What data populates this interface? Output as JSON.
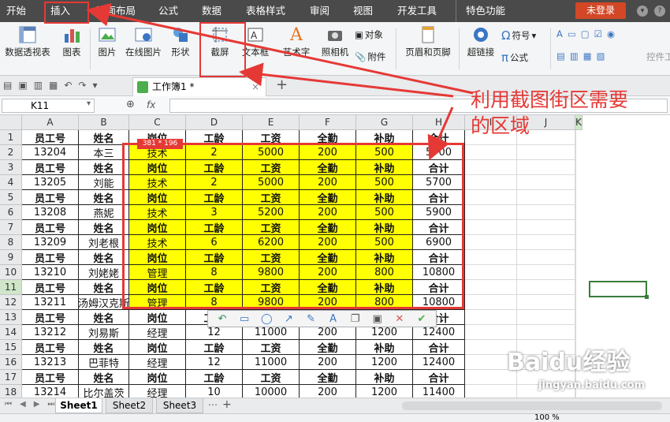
{
  "menu": {
    "items": [
      "开始",
      "插入",
      "页面布局",
      "公式",
      "数据",
      "表格样式",
      "审阅",
      "视图",
      "开发工具",
      "特色功能"
    ],
    "login": "未登录"
  },
  "ribbon": {
    "pivot": "数据透视表",
    "chart": "图表",
    "picture": "图片",
    "online_picture": "在线图片",
    "shapes": "形状",
    "screenshot": "截屏",
    "textbox": "文本框",
    "wordart": "艺术字",
    "camera": "照相机",
    "object": "对象",
    "attachment": "附件",
    "header_footer": "页眉和页脚",
    "hyperlink": "超链接",
    "symbol": "符号",
    "formula": "公式",
    "controls": "控件工"
  },
  "tabs": {
    "doc_title": "工作簿1 *",
    "add": "+"
  },
  "formula_bar": {
    "name_box": "K11",
    "fx": "fx"
  },
  "grid": {
    "columns": [
      "A",
      "B",
      "C",
      "D",
      "E",
      "F",
      "G",
      "H",
      "I",
      "J",
      "K"
    ],
    "rows": [
      {
        "n": "1",
        "cells": [
          "员工号",
          "姓名",
          "岗位",
          "工龄",
          "工资",
          "全勤",
          "补助",
          "合计"
        ],
        "h": true
      },
      {
        "n": "2",
        "cells": [
          "13204",
          "本三",
          "技术",
          "2",
          "5000",
          "200",
          "500",
          "5700"
        ],
        "h": false
      },
      {
        "n": "3",
        "cells": [
          "员工号",
          "姓名",
          "岗位",
          "工龄",
          "工资",
          "全勤",
          "补助",
          "合计"
        ],
        "h": true
      },
      {
        "n": "4",
        "cells": [
          "13205",
          "刘能",
          "技术",
          "2",
          "5000",
          "200",
          "500",
          "5700"
        ],
        "h": false
      },
      {
        "n": "5",
        "cells": [
          "员工号",
          "姓名",
          "岗位",
          "工龄",
          "工资",
          "全勤",
          "补助",
          "合计"
        ],
        "h": true
      },
      {
        "n": "6",
        "cells": [
          "13208",
          "燕妮",
          "技术",
          "3",
          "5200",
          "200",
          "500",
          "5900"
        ],
        "h": false
      },
      {
        "n": "7",
        "cells": [
          "员工号",
          "姓名",
          "岗位",
          "工龄",
          "工资",
          "全勤",
          "补助",
          "合计"
        ],
        "h": true
      },
      {
        "n": "8",
        "cells": [
          "13209",
          "刘老根",
          "技术",
          "6",
          "6200",
          "200",
          "500",
          "6900"
        ],
        "h": false
      },
      {
        "n": "9",
        "cells": [
          "员工号",
          "姓名",
          "岗位",
          "工龄",
          "工资",
          "全勤",
          "补助",
          "合计"
        ],
        "h": true
      },
      {
        "n": "10",
        "cells": [
          "13210",
          "刘姥姥",
          "管理",
          "8",
          "9800",
          "200",
          "800",
          "10800"
        ],
        "h": false
      },
      {
        "n": "11",
        "cells": [
          "员工号",
          "姓名",
          "岗位",
          "工龄",
          "工资",
          "全勤",
          "补助",
          "合计"
        ],
        "h": true
      },
      {
        "n": "12",
        "cells": [
          "13211",
          "汤姆汉克斯",
          "管理",
          "8",
          "9800",
          "200",
          "800",
          "10800"
        ],
        "h": false
      },
      {
        "n": "13",
        "cells": [
          "员工号",
          "姓名",
          "岗位",
          "工龄",
          "工资",
          "全勤",
          "补助",
          "合计"
        ],
        "h": true
      },
      {
        "n": "14",
        "cells": [
          "13212",
          "刘易斯",
          "经理",
          "12",
          "11000",
          "200",
          "1200",
          "12400"
        ],
        "h": false
      },
      {
        "n": "15",
        "cells": [
          "员工号",
          "姓名",
          "岗位",
          "工龄",
          "工资",
          "全勤",
          "补助",
          "合计"
        ],
        "h": true
      },
      {
        "n": "16",
        "cells": [
          "13213",
          "巴菲特",
          "经理",
          "12",
          "11000",
          "200",
          "1200",
          "12400"
        ],
        "h": false
      },
      {
        "n": "17",
        "cells": [
          "员工号",
          "姓名",
          "岗位",
          "工龄",
          "工资",
          "全勤",
          "补助",
          "合计"
        ],
        "h": true
      },
      {
        "n": "18",
        "cells": [
          "13214",
          "比尔盖茨",
          "经理",
          "10",
          "10000",
          "200",
          "1200",
          "11400"
        ],
        "h": false
      }
    ]
  },
  "sheets": [
    "Sheet1",
    "Sheet2",
    "Sheet3"
  ],
  "status": {
    "zoom": "100 %"
  },
  "annotation": {
    "text_line1": "利用截图街区需要",
    "text_line2": "的区域",
    "dimensions": "381 * 196",
    "color": "#e53935"
  },
  "watermark": {
    "brand": "Baidu经验",
    "url": "jingyan.baidu.com"
  },
  "colors": {
    "highlight": "#ffff00",
    "menubar": "#4a4a4a",
    "login": "#d24726"
  }
}
